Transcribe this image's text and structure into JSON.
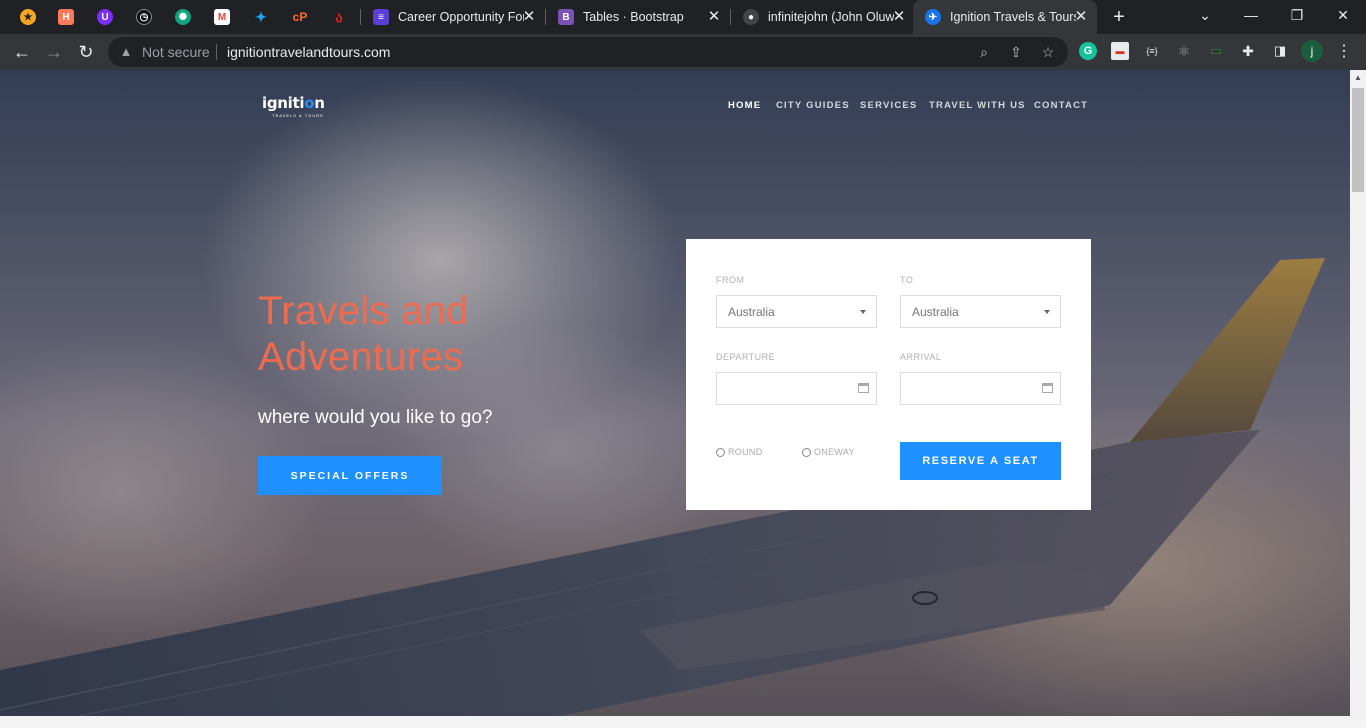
{
  "browser": {
    "tabs": [
      {
        "title": "Career Opportunity For",
        "favicon_color": "#5b3fd6"
      },
      {
        "title": "Tables · Bootstrap",
        "favicon_color": "#7952b3"
      },
      {
        "title": "infinitejohn (John Oluw",
        "favicon_color": "#444444"
      },
      {
        "title": "Ignition Travels & Tours",
        "favicon_color": "#1a73e8",
        "active": true
      }
    ],
    "omnibox": {
      "security_label": "Not secure",
      "url": "ignitiontravelandtours.com"
    },
    "profile_initial": "j"
  },
  "site": {
    "logo": {
      "text_before": "igniti",
      "text_o": "o",
      "text_after": "n",
      "tagline": "TRAVELS & TOURS"
    },
    "nav": [
      "HOME",
      "CITY GUIDES",
      "SERVICES",
      "TRAVEL WITH US",
      "CONTACT"
    ],
    "hero": {
      "title_line1": "Travels and",
      "title_line2": "Adventures",
      "subtitle": "where would you like to go?",
      "cta": "SPECIAL OFFERS"
    },
    "booking": {
      "from_label": "FROM",
      "from_value": "Australia",
      "to_label": "TO",
      "to_value": "Australia",
      "departure_label": "DEPARTURE",
      "arrival_label": "ARRIVAL",
      "round_label": "ROUND",
      "oneway_label": "ONEWAY",
      "submit": "RESERVE A SEAT"
    }
  },
  "colors": {
    "accent": "#1e90ff",
    "hero_title": "#f06b4e"
  }
}
